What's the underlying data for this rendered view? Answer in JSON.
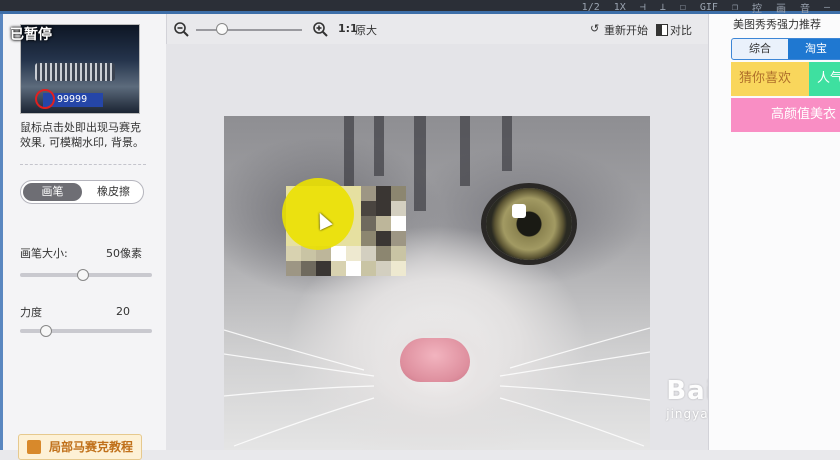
{
  "topbar": {
    "tools": [
      "1/2",
      "1X",
      "⊣",
      "⊥",
      "☐",
      "GIF",
      "❐",
      "控",
      "画",
      "音",
      "–"
    ]
  },
  "left": {
    "thumb_plate": "99999",
    "paused": "已暂停",
    "description": "鼠标点击处即出现马赛克效果, 可模糊水印, 背景。",
    "mode_brush": "画笔",
    "mode_eraser": "橡皮擦",
    "brush_size_label": "画笔大小:",
    "brush_size_value": "50像素",
    "brush_size_level": 0.48,
    "strength_label": "力度",
    "strength_value": "20",
    "strength_level": 0.2,
    "tutorial": "局部马赛克教程"
  },
  "toolbar": {
    "zoom_out_icon": "zoom-out",
    "zoom_in_icon": "zoom-in",
    "ratio_bold": "1:1",
    "ratio_label": "原大",
    "restart_label": "重新开始",
    "compare_label": "对比"
  },
  "right": {
    "title": "美图秀秀强力推荐",
    "tabs": [
      "综合",
      "淘宝"
    ],
    "cells": [
      {
        "text": "猜你喜欢",
        "bg": "#f9d65c",
        "fg": "#b0702b"
      },
      {
        "text": "人气",
        "bg": "#3ee0a0",
        "fg": "#ffffff"
      },
      {
        "text": "高颜值美衣",
        "bg": "#f98ec4",
        "fg": "#ffffff"
      }
    ]
  },
  "watermark": {
    "brand": "Bai☀经验",
    "url": "jingyan.baidu.com"
  },
  "colors": {
    "accent": "#1f78d1",
    "brush": "#ebe100"
  }
}
